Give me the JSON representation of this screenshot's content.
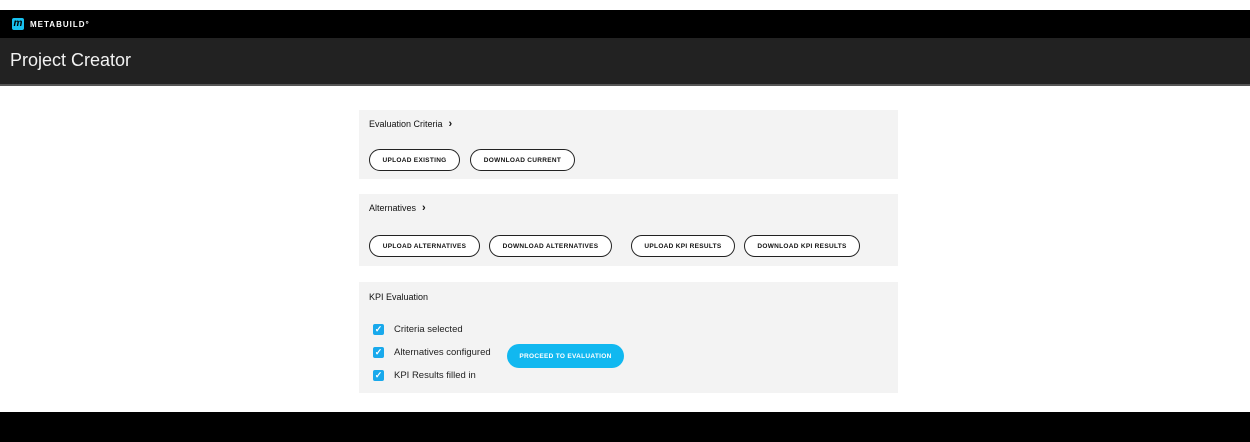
{
  "brand": {
    "logo_letter": "m",
    "logo_text": "METABUILD°"
  },
  "header": {
    "title": "Project Creator"
  },
  "evaluation_criteria": {
    "title": "Evaluation Criteria",
    "upload_label": "UPLOAD EXISTING",
    "download_label": "DOWNLOAD CURRENT"
  },
  "alternatives": {
    "title": "Alternatives",
    "upload_alternatives_label": "UPLOAD ALTERNATIVES",
    "download_alternatives_label": "DOWNLOAD ALTERNATIVES",
    "upload_kpi_label": "UPLOAD KPI RESULTS",
    "download_kpi_label": "DOWNLOAD KPI RESULTS"
  },
  "kpi_evaluation": {
    "title": "KPI Evaluation",
    "checks": [
      {
        "label": "Criteria selected",
        "checked": true
      },
      {
        "label": "Alternatives configured",
        "checked": true
      },
      {
        "label": "KPI Results filled in",
        "checked": true
      }
    ],
    "proceed_label": "PROCEED TO EVALUATION"
  },
  "colors": {
    "accent": "#11b8f0",
    "header_bg": "#222222",
    "card_bg": "#f3f3f3"
  }
}
